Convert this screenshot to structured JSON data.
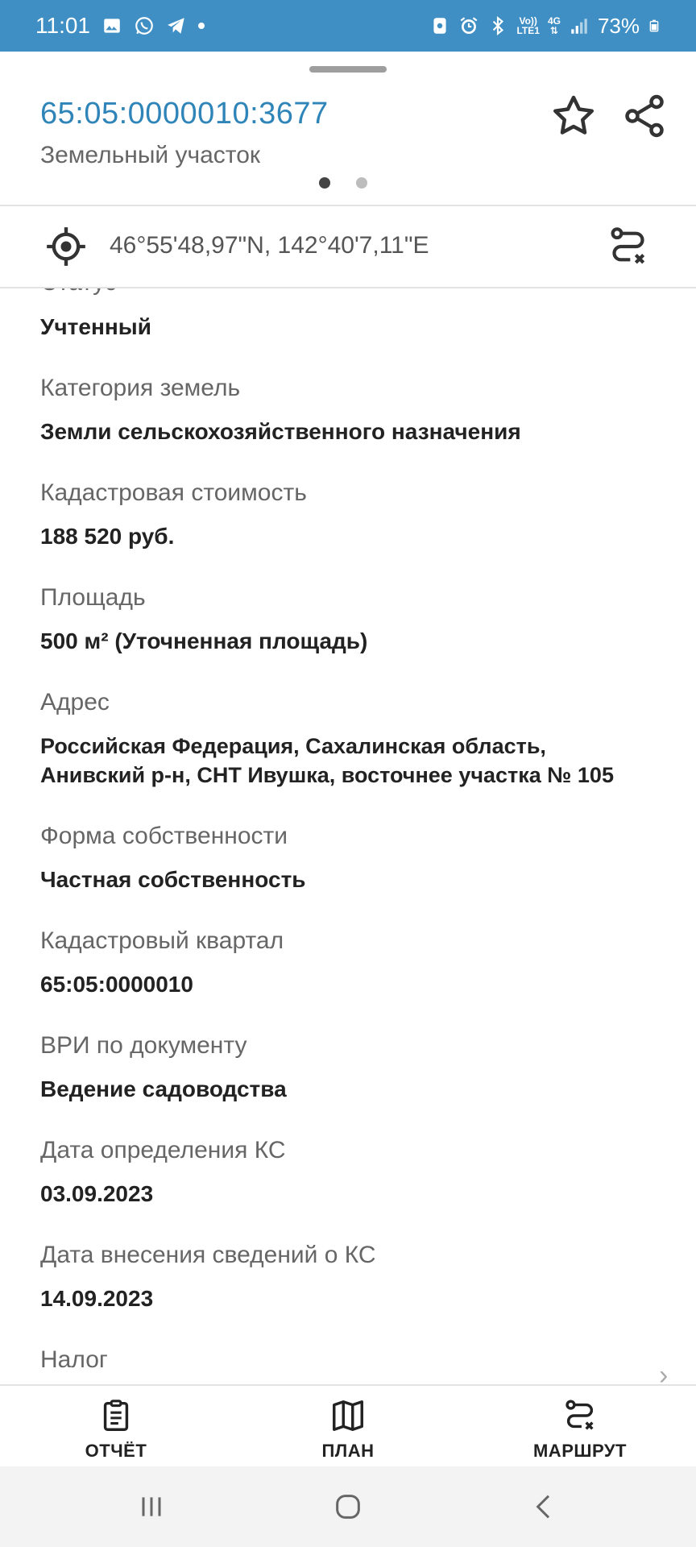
{
  "status_bar": {
    "time": "11:01",
    "network_top": "Vo))",
    "network_bottom": "LTE1",
    "gen": "4G",
    "battery": "73%"
  },
  "header": {
    "cadastral_number": "65:05:0000010:3677",
    "object_type": "Земельный участок"
  },
  "coordinates": "46°55'48,97\"N, 142°40'7,11\"E",
  "partial_label": "Статус",
  "fields": [
    {
      "label": "",
      "value": "Учтенный"
    },
    {
      "label": "Категория земель",
      "value": "Земли сельскохозяйственного назначения"
    },
    {
      "label": "Кадастровая стоимость",
      "value": "188 520 руб."
    },
    {
      "label": "Площадь",
      "value": "500 м² (Уточненная площадь)"
    },
    {
      "label": "Адрес",
      "value": "Российская Федерация, Сахалинская область,\nАнивский р-н, СНТ Ивушка, восточнее участка № 105"
    },
    {
      "label": "Форма собственности",
      "value": "Частная собственность"
    },
    {
      "label": "Кадастровый квартал",
      "value": "65:05:0000010"
    },
    {
      "label": "ВРИ по документу",
      "value": "Ведение садоводства"
    },
    {
      "label": "Дата определения КС",
      "value": "03.09.2023"
    },
    {
      "label": "Дата внесения сведений о КС",
      "value": "14.09.2023"
    },
    {
      "label": "Налог",
      "value": ""
    }
  ],
  "bottom_nav": {
    "report": "ОТЧЁТ",
    "plan": "ПЛАН",
    "route": "МАРШРУТ"
  },
  "colors": {
    "status_bar": "#3f8fc4",
    "accent": "#2f84b8"
  }
}
